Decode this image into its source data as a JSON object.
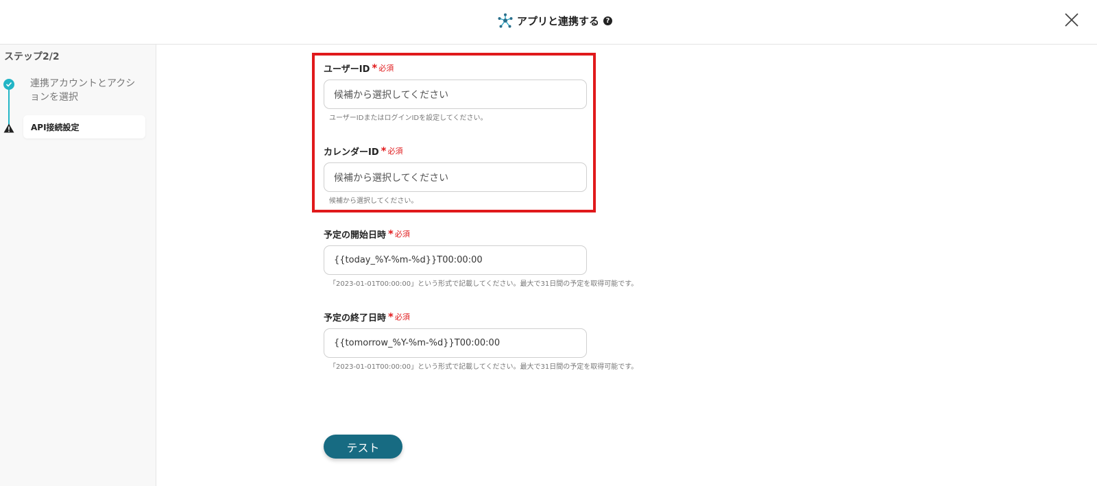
{
  "header": {
    "title": "アプリと連携する",
    "title_icon": "network-hub-icon",
    "help_icon": "question-circle-icon",
    "close_icon": "close-icon"
  },
  "sidebar": {
    "step_label": "ステップ2/2",
    "steps": [
      {
        "label": "連携アカウントとアクションを選択",
        "status": "completed",
        "icon": "check-circle-icon"
      },
      {
        "label": "API接続設定",
        "status": "current",
        "icon": "warning-triangle-icon"
      }
    ]
  },
  "form": {
    "required_mark": "*",
    "required_text": "必須",
    "fields": [
      {
        "label": "ユーザーID",
        "placeholder": "候補から選択してください",
        "help": "ユーザーIDまたはログインIDを設定してください。"
      },
      {
        "label": "カレンダーID",
        "placeholder": "候補から選択してください",
        "help": "候補から選択してください。"
      },
      {
        "label": "予定の開始日時",
        "value": "{{today_%Y-%m-%d}}T00:00:00",
        "help": "「2023-01-01T00:00:00」という形式で記載してください。最大で31日間の予定を取得可能です。"
      },
      {
        "label": "予定の終了日時",
        "value": "{{tomorrow_%Y-%m-%d}}T00:00:00",
        "help": "「2023-01-01T00:00:00」という形式で記載してください。最大で31日間の予定を取得可能です。"
      }
    ],
    "test_button": "テスト"
  },
  "colors": {
    "accent": "#22b5c6",
    "required": "#e0191b",
    "button": "#176b82",
    "highlight_border": "#e0191b"
  }
}
